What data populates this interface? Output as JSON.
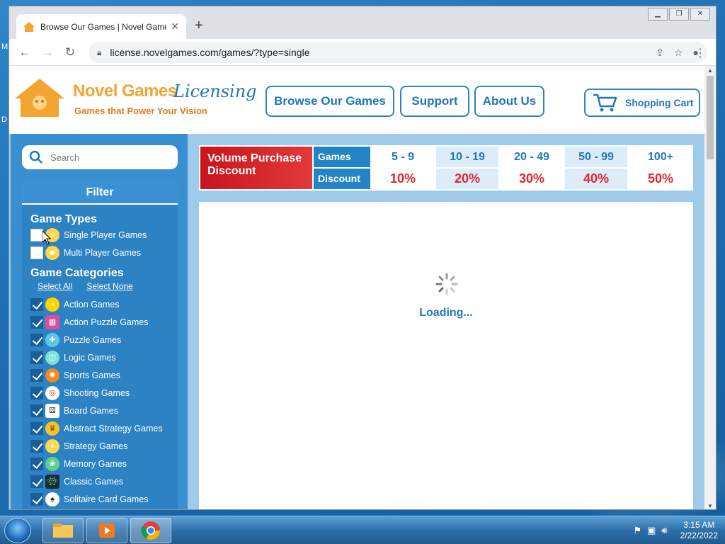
{
  "desktop": {
    "left_labels": [
      "M",
      "D"
    ]
  },
  "browser": {
    "tab_title": "Browse Our Games | Novel Game",
    "url": "license.novelgames.com/games/?type=single",
    "new_tab_symbol": "+",
    "close_symbol": "✕"
  },
  "site": {
    "brand_primary": "Novel Games",
    "brand_secondary": "Licensing",
    "tagline": "Games that Power Your Vision",
    "nav": {
      "browse": "Browse Our Games",
      "support": "Support",
      "about": "About Us",
      "cart": "Shopping Cart"
    }
  },
  "sidebar": {
    "search_placeholder": "Search",
    "filter_title": "Filter",
    "game_types_title": "Game Types",
    "game_types": [
      {
        "label": "Single Player Games",
        "checked": false
      },
      {
        "label": "Multi Player Games",
        "checked": false
      }
    ],
    "categories_title": "Game Categories",
    "select_all": "Select All",
    "select_none": "Select None",
    "categories": [
      {
        "label": "Action Games",
        "icon": "pacman-icon"
      },
      {
        "label": "Action Puzzle Games",
        "icon": "blocks-icon"
      },
      {
        "label": "Puzzle Games",
        "icon": "puzzle-icon"
      },
      {
        "label": "Logic Games",
        "icon": "cube-icon"
      },
      {
        "label": "Sports Games",
        "icon": "basketball-icon"
      },
      {
        "label": "Shooting Games",
        "icon": "target-icon"
      },
      {
        "label": "Board Games",
        "icon": "dice-icon"
      },
      {
        "label": "Abstract Strategy Games",
        "icon": "crown-icon"
      },
      {
        "label": "Strategy Games",
        "icon": "bulb-icon"
      },
      {
        "label": "Memory Games",
        "icon": "brain-icon"
      },
      {
        "label": "Classic Games",
        "icon": "invader-icon"
      },
      {
        "label": "Solitaire Card Games",
        "icon": "card-icon"
      }
    ]
  },
  "discount": {
    "title_line1": "Volume Purchase",
    "title_line2": "Discount",
    "games_label": "Games",
    "discount_label": "Discount",
    "tiers": [
      {
        "range": "5 - 9",
        "discount": "10%"
      },
      {
        "range": "10 - 19",
        "discount": "20%"
      },
      {
        "range": "20 - 49",
        "discount": "30%"
      },
      {
        "range": "50 - 99",
        "discount": "40%"
      },
      {
        "range": "100+",
        "discount": "50%"
      }
    ]
  },
  "main": {
    "loading_text": "Loading..."
  },
  "taskbar": {
    "time": "3:15 AM",
    "date": "2/22/2022"
  },
  "colors": {
    "accent_blue": "#1f77b9",
    "brand_orange": "#f2a531",
    "discount_red": "#e0262d"
  }
}
